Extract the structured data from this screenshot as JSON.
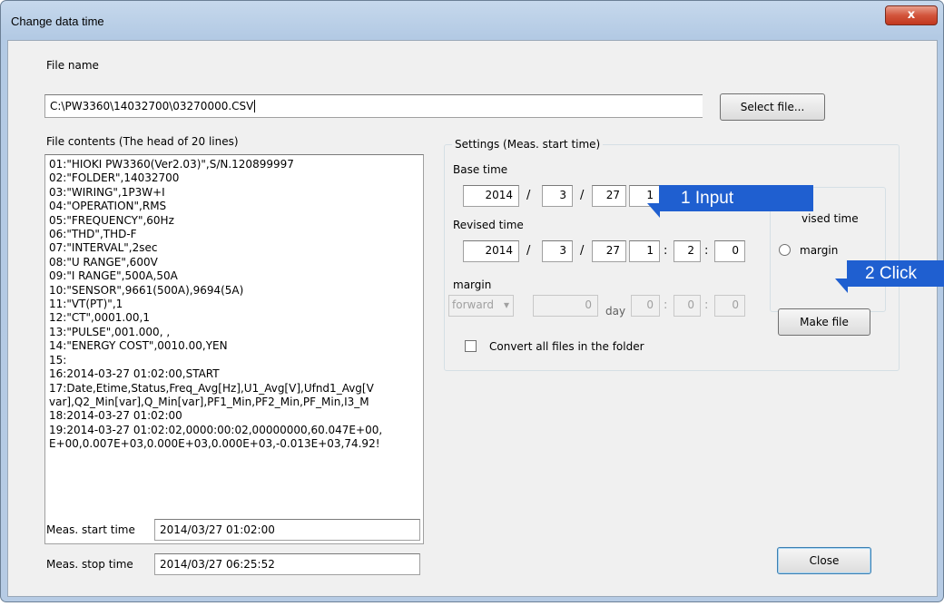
{
  "window": {
    "title": "Change data time",
    "close_glyph": "x"
  },
  "file": {
    "label": "File name",
    "value": "C:\\PW3360\\14032700\\03270000.CSV",
    "select_button": "Select file..."
  },
  "contents": {
    "label": "File contents (The head of 20 lines)",
    "lines": [
      "01:\"HIOKI PW3360(Ver2.03)\",S/N.120899997",
      "02:\"FOLDER\",14032700",
      "03:\"WIRING\",1P3W+I",
      "04:\"OPERATION\",RMS",
      "05:\"FREQUENCY\",60Hz",
      "06:\"THD\",THD-F",
      "07:\"INTERVAL\",2sec",
      "08:\"U RANGE\",600V",
      "09:\"I RANGE\",500A,50A",
      "10:\"SENSOR\",9661(500A),9694(5A)",
      "11:\"VT(PT)\",1",
      "12:\"CT\",0001.00,1",
      "13:\"PULSE\",001.000, ,",
      "14:\"ENERGY COST\",0010.00,YEN",
      "15:",
      "16:2014-03-27 01:02:00,START",
      "17:Date,Etime,Status,Freq_Avg[Hz],U1_Avg[V],Ufnd1_Avg[V",
      "var],Q2_Min[var],Q_Min[var],PF1_Min,PF2_Min,PF_Min,I3_M",
      "18:2014-03-27 01:02:00",
      "19:2014-03-27 01:02:02,0000:00:02,00000000,60.047E+00,",
      "E+00,0.007E+03,0.000E+03,0.000E+03,-0.013E+03,74.92!"
    ]
  },
  "meas": {
    "start_label": "Meas. start time",
    "start_value": "2014/03/27 01:02:00",
    "stop_label": "Meas. stop time",
    "stop_value": "2014/03/27 06:25:52"
  },
  "settings": {
    "title": "Settings (Meas. start time)",
    "base_label": "Base time",
    "base": {
      "year": "2014",
      "month": "3",
      "day": "27",
      "hour": "1"
    },
    "revised_label": "Revised time",
    "revised": {
      "year": "2014",
      "month": "3",
      "day": "27",
      "hour": "1",
      "minute": "2",
      "second": "0"
    },
    "margin_label": "margin",
    "margin": {
      "direction": "forward",
      "days": "0",
      "day_unit": "day",
      "hour": "0",
      "minute": "0",
      "second": "0"
    },
    "radio_revised": "Revised time",
    "radio_revised_visible": "vised time",
    "radio_margin": "margin",
    "convert_label": "Convert all files in the folder",
    "make_button": "Make file",
    "date_sep": "/",
    "time_sep": ":"
  },
  "close_button": "Close",
  "callouts": {
    "input": "1 Input",
    "click": "2 Click",
    "color": "#1f5fd0"
  }
}
